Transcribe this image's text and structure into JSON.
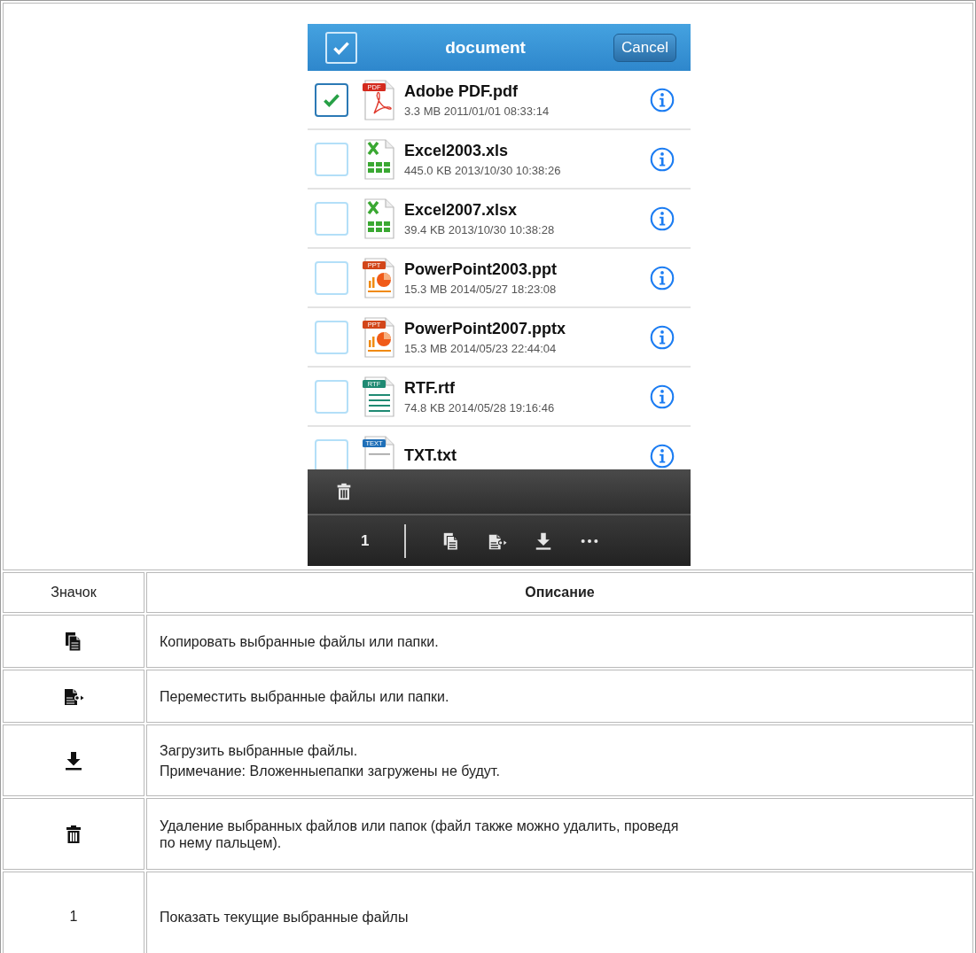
{
  "header": {
    "select_all_checked": true,
    "title": "document",
    "cancel": "Cancel"
  },
  "files": [
    {
      "name": "Adobe PDF.pdf",
      "meta": "3.3 MB 2011/01/01 08:33:14",
      "kind": "pdf",
      "tag": "PDF",
      "checked": true
    },
    {
      "name": "Excel2003.xls",
      "meta": "445.0 KB 2013/10/30 10:38:26",
      "kind": "excel",
      "checked": false
    },
    {
      "name": "Excel2007.xlsx",
      "meta": "39.4 KB 2013/10/30 10:38:28",
      "kind": "excel",
      "checked": false
    },
    {
      "name": "PowerPoint2003.ppt",
      "meta": "15.3 MB 2014/05/27 18:23:08",
      "kind": "ppt",
      "tag": "PPT",
      "checked": false
    },
    {
      "name": "PowerPoint2007.pptx",
      "meta": "15.3 MB 2014/05/23 22:44:04",
      "kind": "ppt",
      "tag": "PPT",
      "checked": false
    },
    {
      "name": "RTF.rtf",
      "meta": "74.8 KB 2014/05/28 19:16:46",
      "kind": "rtf",
      "tag": "RTF",
      "checked": false
    },
    {
      "name": "TXT.txt",
      "kind": "text",
      "tag": "TEXT",
      "checked": false
    }
  ],
  "toolbar": {
    "top": [
      {
        "kind": "trash"
      }
    ],
    "count": "1",
    "actions": [
      {
        "kind": "copy"
      },
      {
        "kind": "move"
      },
      {
        "kind": "download"
      },
      {
        "kind": "more"
      }
    ]
  },
  "table": {
    "columns": [
      "Значок",
      "Описание"
    ],
    "rows": [
      {
        "icon": {
          "kind": "copy"
        },
        "lines": [
          "Копировать выбранные файлы или папки."
        ]
      },
      {
        "icon": {
          "kind": "move"
        },
        "lines": [
          "Переместить выбранные файлы или папки."
        ]
      },
      {
        "icon": {
          "kind": "download"
        },
        "lines": [
          "Загрузить выбранные файлы.",
          "Примечание: Вложенныепапки загружены не будут."
        ]
      },
      {
        "icon": {
          "kind": "trash"
        },
        "lines": [
          "Удаление выбранных файлов или папок (файл также можно удалить, проведя по нему пальцем)."
        ]
      },
      {
        "icon": {
          "kind": "text",
          "text": "1"
        },
        "lines": [
          "Показать текущие выбранные файлы"
        ]
      }
    ]
  }
}
